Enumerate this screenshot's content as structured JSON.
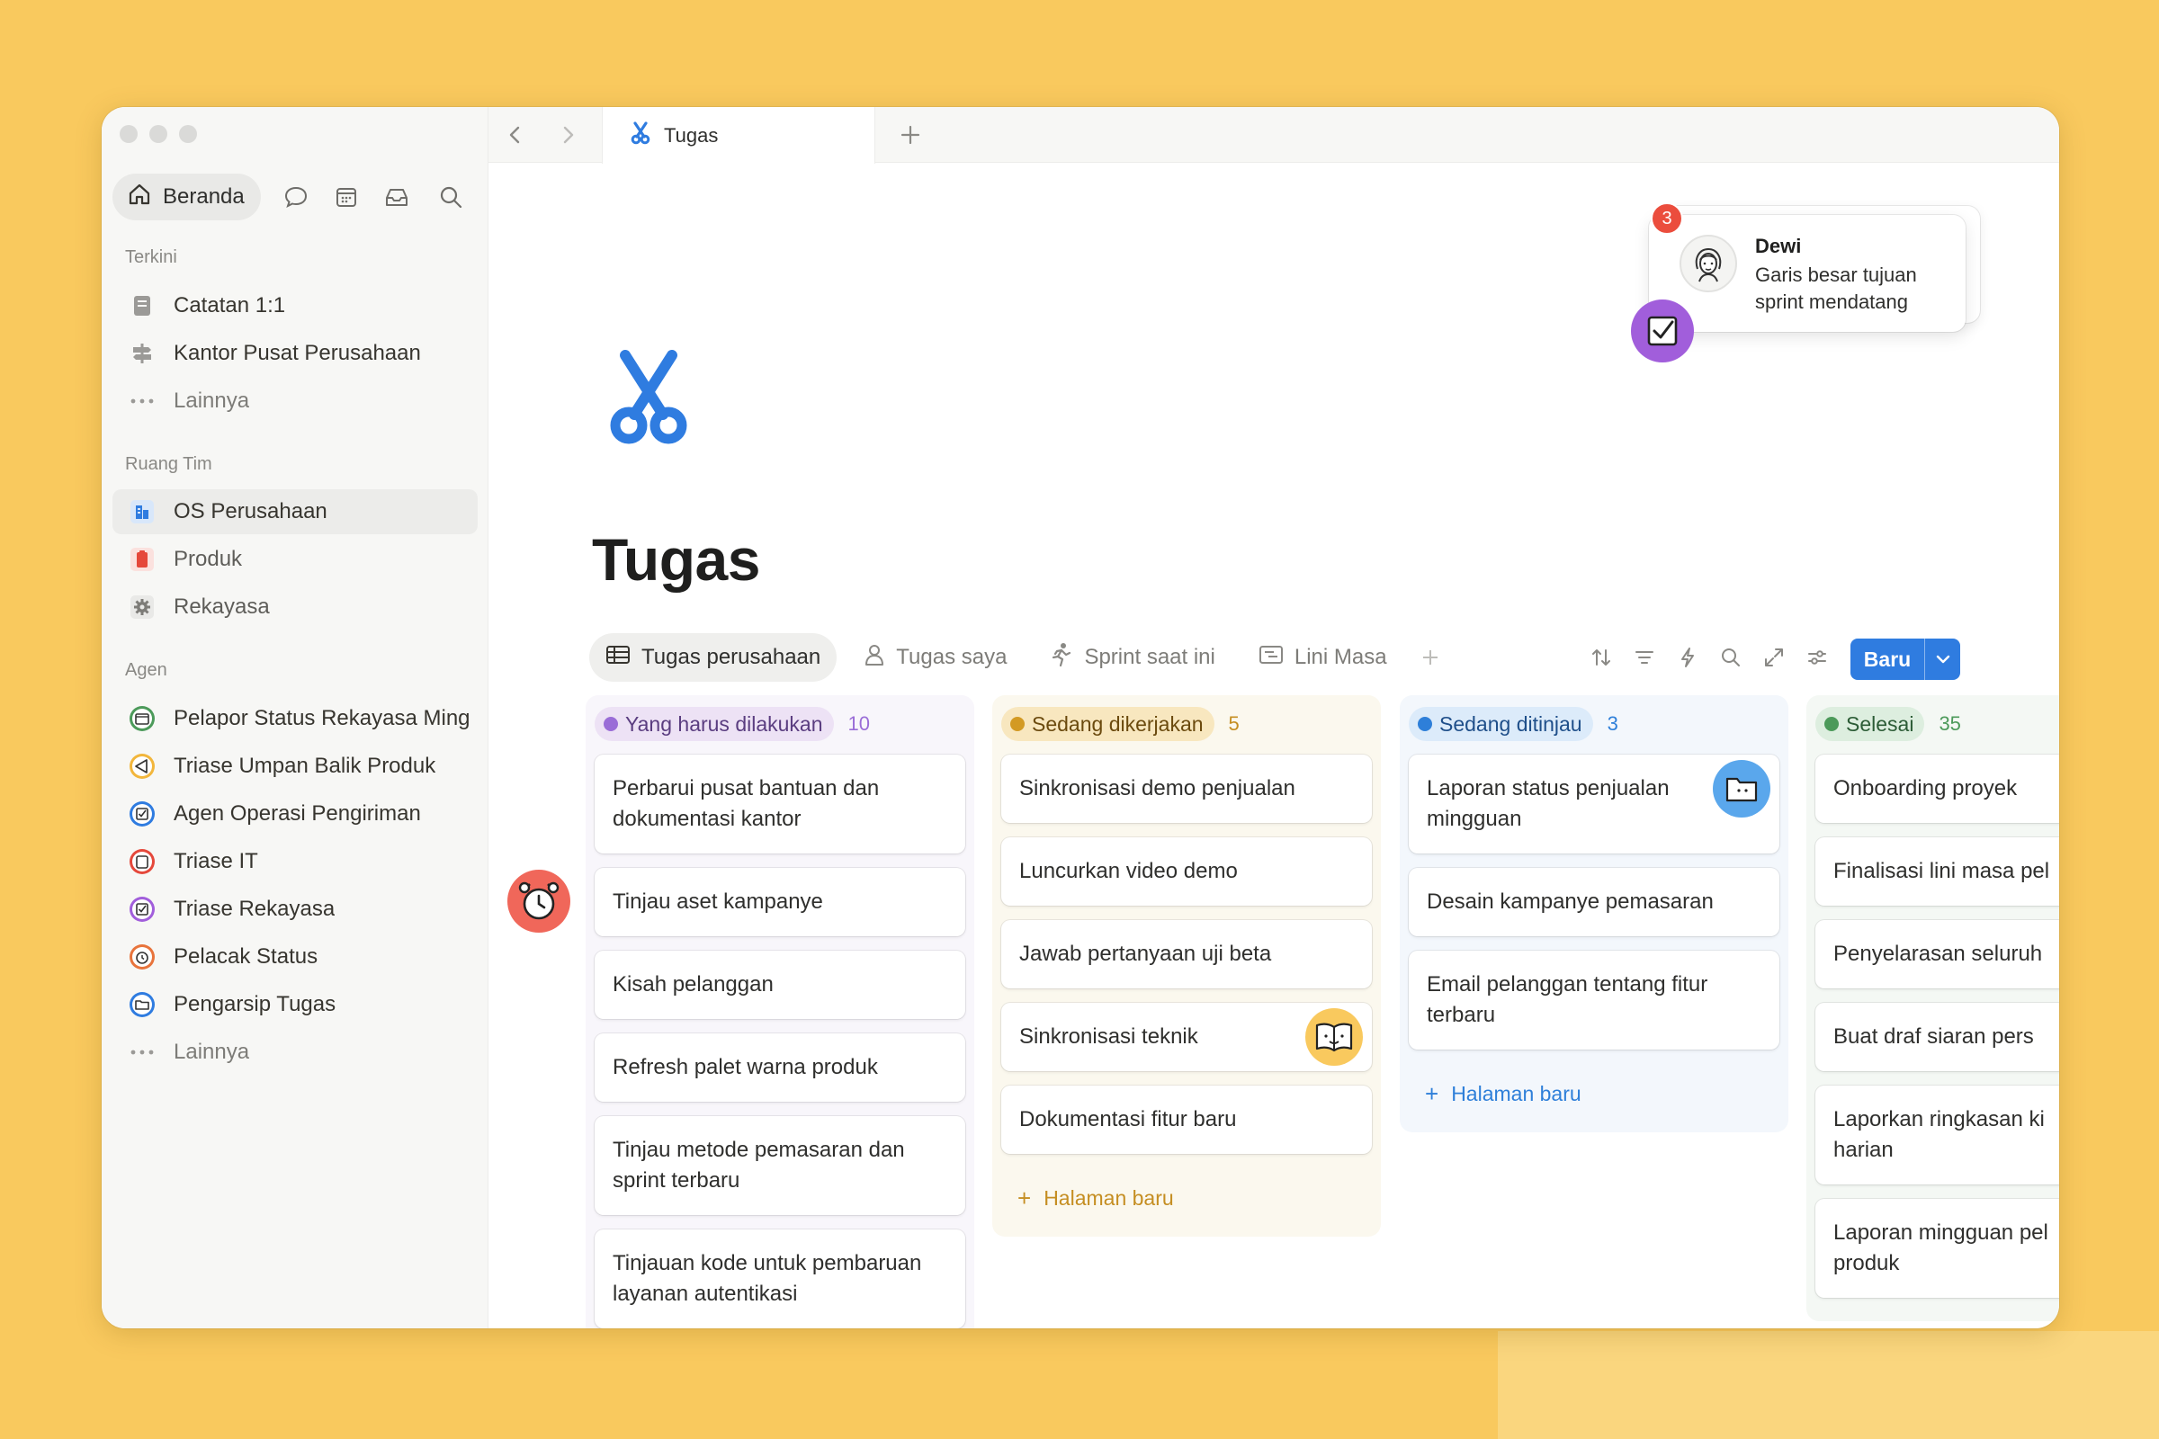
{
  "tab": {
    "title": "Tugas"
  },
  "sidebar": {
    "home_label": "Beranda",
    "sections": {
      "recent": "Terkini",
      "teamspaces": "Ruang Tim",
      "agents": "Agen"
    },
    "recent_items": [
      {
        "label": "Catatan 1:1",
        "icon": "document-icon"
      },
      {
        "label": "Kantor Pusat Perusahaan",
        "icon": "signpost-icon"
      },
      {
        "label": "Lainnya",
        "icon": "more-icon"
      }
    ],
    "team_items": [
      {
        "label": "OS Perusahaan",
        "icon": "building-icon",
        "active": true
      },
      {
        "label": "Produk",
        "icon": "clipboard-icon"
      },
      {
        "label": "Rekayasa",
        "icon": "gear-icon"
      }
    ],
    "agent_items": [
      {
        "label": "Pelapor Status Rekayasa Ming",
        "icon": "agent-report-icon"
      },
      {
        "label": "Triase Umpan Balik Produk",
        "icon": "megaphone-icon"
      },
      {
        "label": "Agen Operasi Pengiriman",
        "icon": "checkbox-icon"
      },
      {
        "label": "Triase IT",
        "icon": "lifebuoy-icon"
      },
      {
        "label": "Triase Rekayasa",
        "icon": "checkbox-icon"
      },
      {
        "label": "Pelacak Status",
        "icon": "alarm-icon"
      },
      {
        "label": "Pengarsip Tugas",
        "icon": "folder-icon"
      },
      {
        "label": "Lainnya",
        "icon": "more-icon"
      }
    ]
  },
  "page": {
    "title": "Tugas",
    "icon": "scissors-icon",
    "views": [
      {
        "label": "Tugas perusahaan",
        "icon": "table-icon",
        "active": true
      },
      {
        "label": "Tugas saya",
        "icon": "person-icon"
      },
      {
        "label": "Sprint saat ini",
        "icon": "runner-icon"
      },
      {
        "label": "Lini Masa",
        "icon": "timeline-icon"
      }
    ],
    "new_button": "Baru"
  },
  "board": {
    "new_page_label": "Halaman baru",
    "columns": [
      {
        "status": "Yang harus dilakukan",
        "count": "10",
        "colors": {
          "bg": "#F8F6FB",
          "pill": "#EDE2F5",
          "dot": "#9A6DD7",
          "text": "#5A3D80",
          "count": "#9A6DD7"
        },
        "cards": [
          "Perbarui pusat bantuan dan dokumentasi kantor",
          "Tinjau aset kampanye",
          "Kisah pelanggan",
          "Refresh palet warna produk",
          "Tinjau metode pemasaran dan sprint terbaru",
          "Tinjauan kode untuk pembaruan layanan autentikasi"
        ]
      },
      {
        "status": "Sedang dikerjakan",
        "count": "5",
        "colors": {
          "bg": "#FBF8EE",
          "pill": "#F8E7BF",
          "dot": "#D39A23",
          "text": "#6B4A0E",
          "count": "#C58E22"
        },
        "cards": [
          "Sinkronisasi demo penjualan",
          "Luncurkan video demo",
          "Jawab pertanyaan uji beta",
          "Sinkronisasi teknik",
          "Dokumentasi fitur baru"
        ]
      },
      {
        "status": "Sedang ditinjau",
        "count": "3",
        "colors": {
          "bg": "#F3F7FC",
          "pill": "#DCEBFA",
          "dot": "#2E7FD9",
          "text": "#1F4F8A",
          "count": "#2E7FD9"
        },
        "cards": [
          "Laporan status penjualan mingguan",
          "Desain kampanye pemasaran",
          "Email pelanggan tentang fitur terbaru"
        ]
      },
      {
        "status": "Selesai",
        "count": "35",
        "colors": {
          "bg": "#F4F8F4",
          "pill": "#DDEEDF",
          "dot": "#4C9A5A",
          "text": "#2C5C36",
          "count": "#4C9A5A"
        },
        "cards": [
          "Onboarding proyek",
          "Finalisasi lini masa pel",
          "Penyelarasan seluruh",
          "Buat draf siaran pers",
          "Laporkan ringkasan ki harian",
          "Laporan mingguan pel produk"
        ]
      }
    ]
  },
  "notification": {
    "badge_count": "3",
    "name": "Dewi",
    "message": "Garis besar tujuan sprint mendatang"
  }
}
